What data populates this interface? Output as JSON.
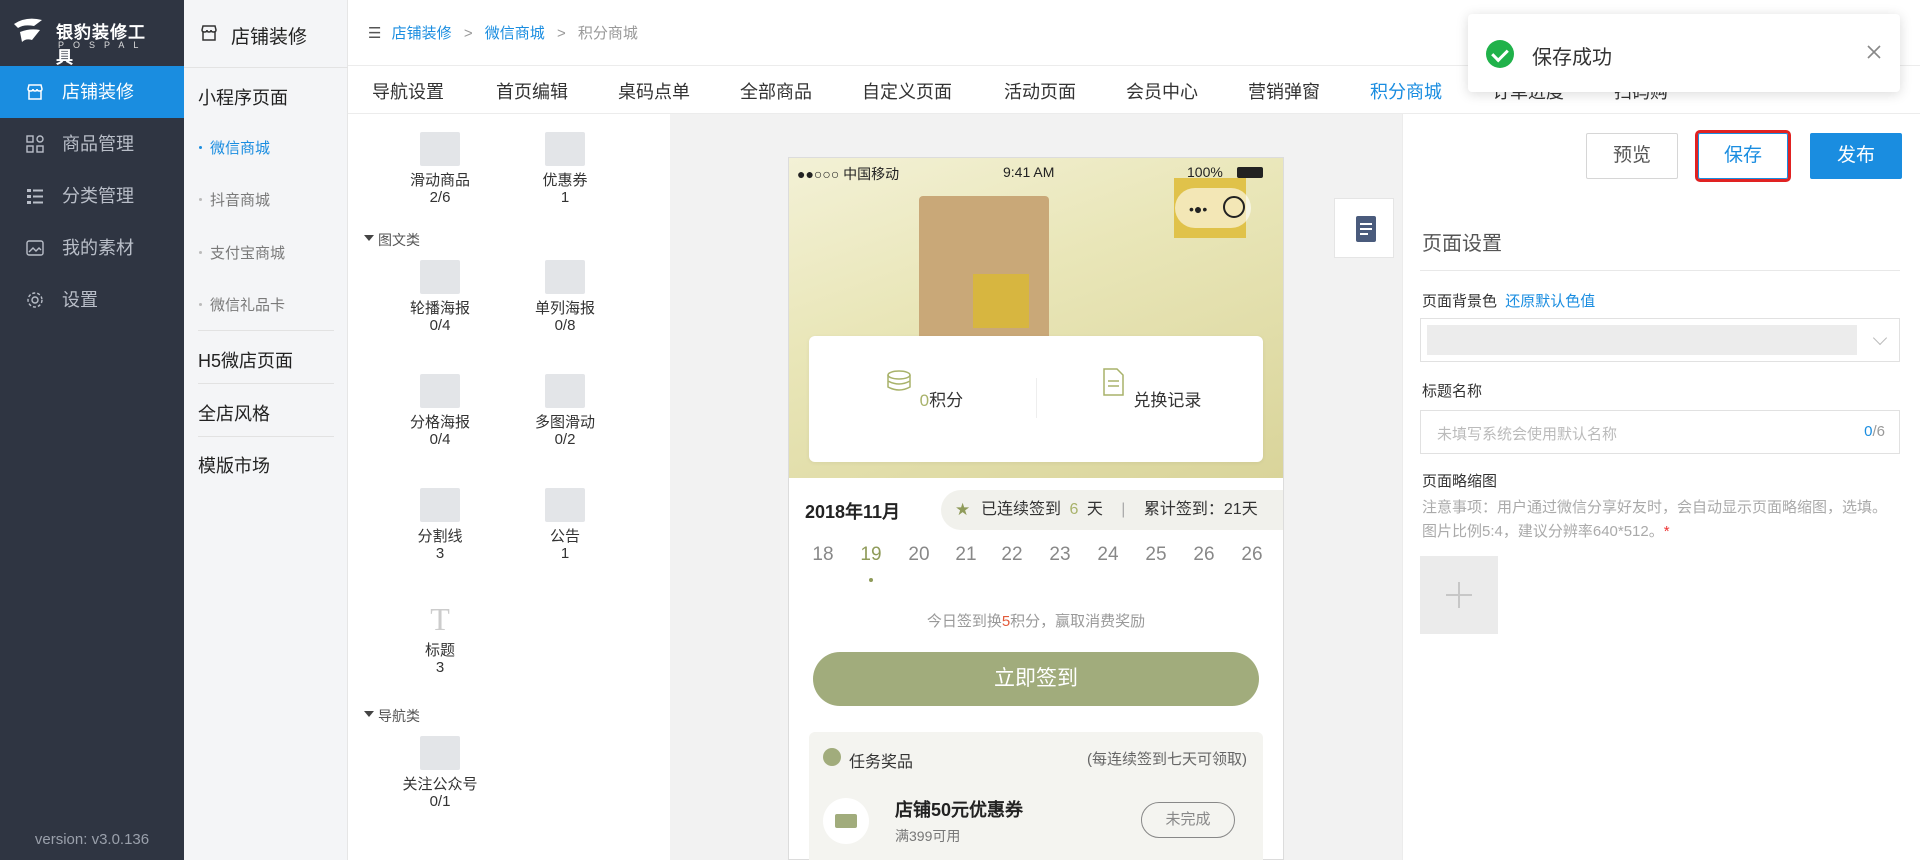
{
  "sidebar": {
    "logo_title": "银豹装修工具",
    "logo_sub": "POSPAL",
    "items": [
      {
        "label": "店铺装修",
        "icon": "store-icon",
        "active": true
      },
      {
        "label": "商品管理",
        "icon": "grid-icon",
        "active": false
      },
      {
        "label": "分类管理",
        "icon": "list-icon",
        "active": false
      },
      {
        "label": "我的素材",
        "icon": "image-icon",
        "active": false
      },
      {
        "label": "设置",
        "icon": "gear-icon",
        "active": false
      }
    ],
    "version": "version: v3.0.136"
  },
  "subnav": {
    "title": "店铺装修",
    "sections": [
      {
        "label": "小程序页面"
      },
      {
        "label": "H5微店页面"
      },
      {
        "label": "全店风格"
      },
      {
        "label": "模版市场"
      }
    ],
    "links": [
      "微信商城",
      "抖音商城",
      "支付宝商城",
      "微信礼品卡"
    ],
    "active_link": "微信商城"
  },
  "breadcrumb": {
    "items": [
      "店铺装修",
      "微信商城",
      "积分商城"
    ],
    "sep": ">"
  },
  "tabs": [
    "导航设置",
    "首页编辑",
    "桌码点单",
    "全部商品",
    "自定义页面",
    "活动页面",
    "会员中心",
    "营销弹窗",
    "积分商城",
    "订单进度",
    "扫码购"
  ],
  "active_tab": "积分商城",
  "components": {
    "group_graphic": "图文类",
    "group_nav": "导航类",
    "items": [
      {
        "label": "滑动商品",
        "count": "2/6"
      },
      {
        "label": "优惠券",
        "count": "1"
      },
      {
        "label": "轮播海报",
        "count": "0/4"
      },
      {
        "label": "单列海报",
        "count": "0/8"
      },
      {
        "label": "分格海报",
        "count": "0/4"
      },
      {
        "label": "多图滑动",
        "count": "0/2"
      },
      {
        "label": "分割线",
        "count": "3"
      },
      {
        "label": "公告",
        "count": "1"
      },
      {
        "label": "标题",
        "count": "3"
      },
      {
        "label": "关注公众号",
        "count": "0/1"
      }
    ]
  },
  "phone": {
    "carrier": "●●○○○ 中国移动",
    "time": "9:41 AM",
    "battery": "100%",
    "points_value": "0",
    "points_label": "积分",
    "records_label": "兑换记录",
    "month": "2018年11月",
    "streak_prefix": "已连续签到",
    "streak_days": "6",
    "streak_unit": "天",
    "total_label": "累计签到：21天",
    "days": [
      "18",
      "19",
      "20",
      "21",
      "22",
      "23",
      "24",
      "25",
      "26",
      "26"
    ],
    "current_day": "19",
    "hint_pre": "今日签到换",
    "hint_num": "5",
    "hint_post": "积分，赢取消费奖励",
    "sign_button": "立即签到",
    "task_title": "任务奖品",
    "task_rule": "(每连续签到七天可领取)",
    "task_name": "店铺50元优惠券",
    "task_cond": "满399可用",
    "task_status": "未完成"
  },
  "actions": {
    "preview": "预览",
    "save": "保存",
    "publish": "发布"
  },
  "settings": {
    "title": "页面设置",
    "bg_label": "页面背景色",
    "bg_reset": "还原默认色值",
    "name_label": "标题名称",
    "name_placeholder": "未填写系统会使用默认名称",
    "name_count": "0",
    "name_max": "/6",
    "thumb_label": "页面略缩图",
    "thumb_note": "注意事项：用户通过微信分享好友时，会自动显示页面略缩图，选填。图片比例5:4，建议分辨率640*512。",
    "required_mark": "*"
  },
  "toast": {
    "message": "保存成功"
  },
  "colors": {
    "primary": "#1a8de0",
    "sidebar": "#2f3542",
    "olive": "#a1ac7c",
    "success": "#20b24a"
  }
}
